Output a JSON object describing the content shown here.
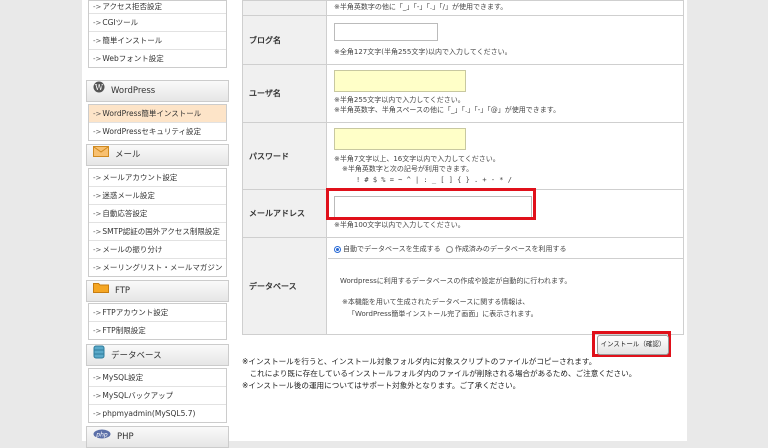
{
  "sidebar": {
    "group1": [
      "アクセス拒否設定",
      "CGIツール",
      "簡単インストール",
      "Webフォント設定"
    ],
    "wordpress": {
      "title": "WordPress",
      "items": [
        "WordPress簡単インストール",
        "WordPressセキュリティ設定"
      ]
    },
    "mail": {
      "title": "メール",
      "items": [
        "メールアカウント設定",
        "迷惑メール設定",
        "自動応答設定",
        "SMTP認証の国外アクセス制限設定",
        "メールの振り分け",
        "メーリングリスト・メールマガジン"
      ]
    },
    "ftp": {
      "title": "FTP",
      "items": [
        "FTPアカウント設定",
        "FTP制限設定"
      ]
    },
    "database": {
      "title": "データベース",
      "items": [
        "MySQL設定",
        "MySQLバックアップ",
        "phpmyadmin(MySQL5.7)"
      ]
    },
    "php": {
      "title": "PHP"
    }
  },
  "form": {
    "top_note": "※半角英数字の他に「_」「-」「.」「/」が使用できます。",
    "blog": {
      "label": "ブログ名",
      "value": "",
      "note": "※全角127文字(半角255文字)以内で入力してください。"
    },
    "user": {
      "label": "ユーザ名",
      "value": "",
      "note1": "※半角255文字以内で入力してください。",
      "note2": "※半角英数字、半角スペースの他に「_」「.」「-」「@」が使用できます。"
    },
    "password": {
      "label": "パスワード",
      "value": "",
      "note1": "※半角7文字以上、16文字以内で入力してください。",
      "note2": "※半角英数字と次の記号が利用できます。",
      "symbols": "! # $ % = ~ ^ | : _ [ ] { } . + - * /"
    },
    "email": {
      "label": "メールアドレス",
      "value": "",
      "note": "※半角100文字以内で入力してください。"
    },
    "database": {
      "label": "データベース",
      "option_auto": "自動でデータベースを生成する",
      "option_existing": "作成済みのデータベースを利用する",
      "desc1": "Wordpressに利用するデータベースの作成や設定が自動的に行われます。",
      "desc2": "※本機能を用いて生成されたデータベースに関する情報は、",
      "desc3": "「WordPress簡単インストール完了画面」に表示されます。"
    }
  },
  "install_button": "インストール（確認）",
  "footer": {
    "line1": "※インストールを行うと、インストール対象フォルダ内に対象スクリプトのファイルがコピーされます。",
    "line2": "　これにより既に存在しているインストールフォルダ内のファイルが削除される場合があるため、ご注意ください。",
    "line3": "※インストール後の運用についてはサポート対象外となります。ご了承ください。"
  },
  "colors": {
    "highlight": "#e0101a",
    "input_yellow": "#ffffc8",
    "active_menu": "#fde4c8"
  }
}
